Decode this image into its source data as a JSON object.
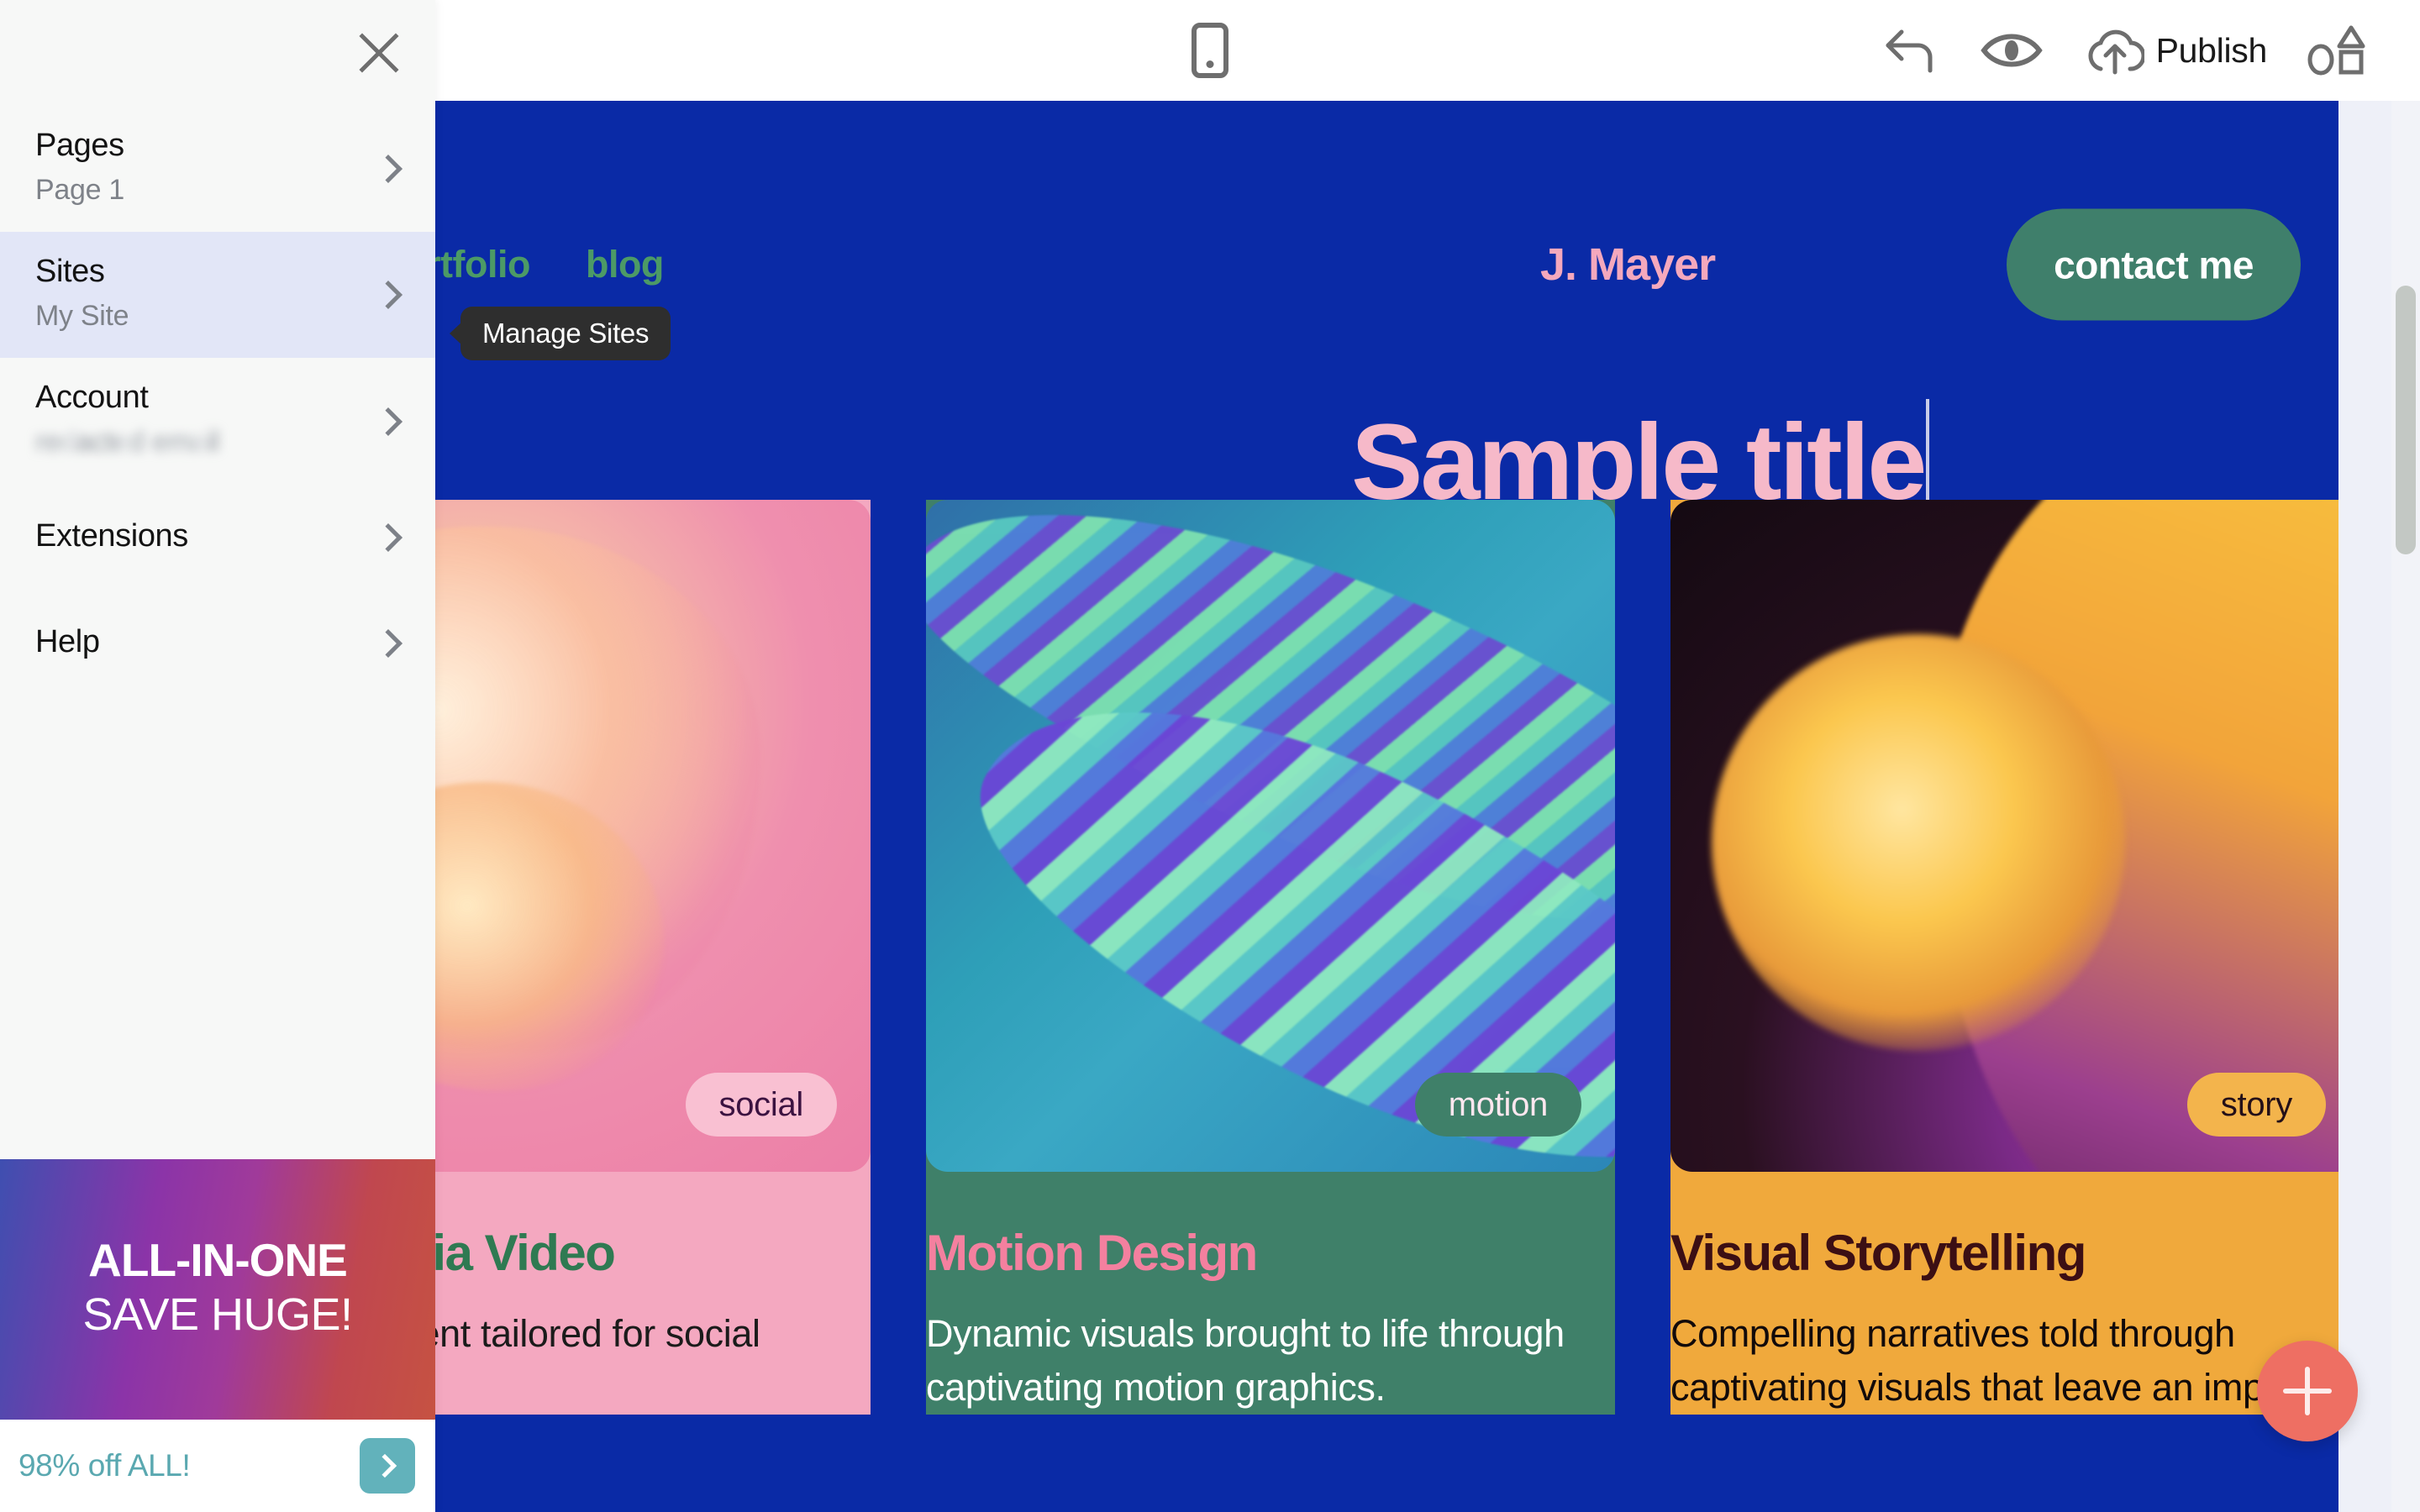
{
  "toolbar": {
    "device_icon": "mobile-device-icon",
    "undo_icon": "undo-arrow-icon",
    "preview_icon": "eye-icon",
    "publish_icon": "cloud-upload-icon",
    "publish_label": "Publish",
    "shapes_icon": "shapes-icon"
  },
  "panel": {
    "close_icon": "close-icon",
    "items": [
      {
        "title": "Pages",
        "sub": "Page 1",
        "active": false,
        "redacted": false
      },
      {
        "title": "Sites",
        "sub": "My Site",
        "active": true,
        "redacted": false
      },
      {
        "title": "Account",
        "sub": "",
        "active": false,
        "redacted": true
      },
      {
        "title": "Extensions",
        "sub": "",
        "active": false,
        "redacted": false
      },
      {
        "title": "Help",
        "sub": "",
        "active": false,
        "redacted": false
      }
    ],
    "promo": {
      "line1": "ALL-IN-ONE",
      "line2": "SAVE HUGE!",
      "offer": "98% off ALL!",
      "next_icon": "chevron-right-icon"
    }
  },
  "tooltip": {
    "text": "Manage Sites"
  },
  "site": {
    "nav": [
      {
        "label": "portfolio"
      },
      {
        "label": "blog"
      }
    ],
    "logo": "J. Mayer",
    "contact_label": "contact me",
    "hero_title": "Sample title",
    "cards": [
      {
        "tag": "social",
        "title": "Social Media Video",
        "desc": "Engaging content tailored for social platforms."
      },
      {
        "tag": "motion",
        "title": "Motion Design",
        "desc": "Dynamic visuals brought to life through captivating motion graphics."
      },
      {
        "tag": "story",
        "title": "Visual Storytelling",
        "desc": "Compelling narratives told through captivating visuals that leave an impact."
      }
    ]
  },
  "add_button": {
    "icon": "plus-icon"
  },
  "colors": {
    "site_background": "#0a2aa6",
    "hero_title": "#f6b9c9",
    "nav_link": "#4c9a66",
    "contact_button": "#3f7f6b",
    "panel_active_row": "#e2e6f7",
    "add_button": "#ee6f63",
    "promo_offer": "#5aa8b0"
  }
}
